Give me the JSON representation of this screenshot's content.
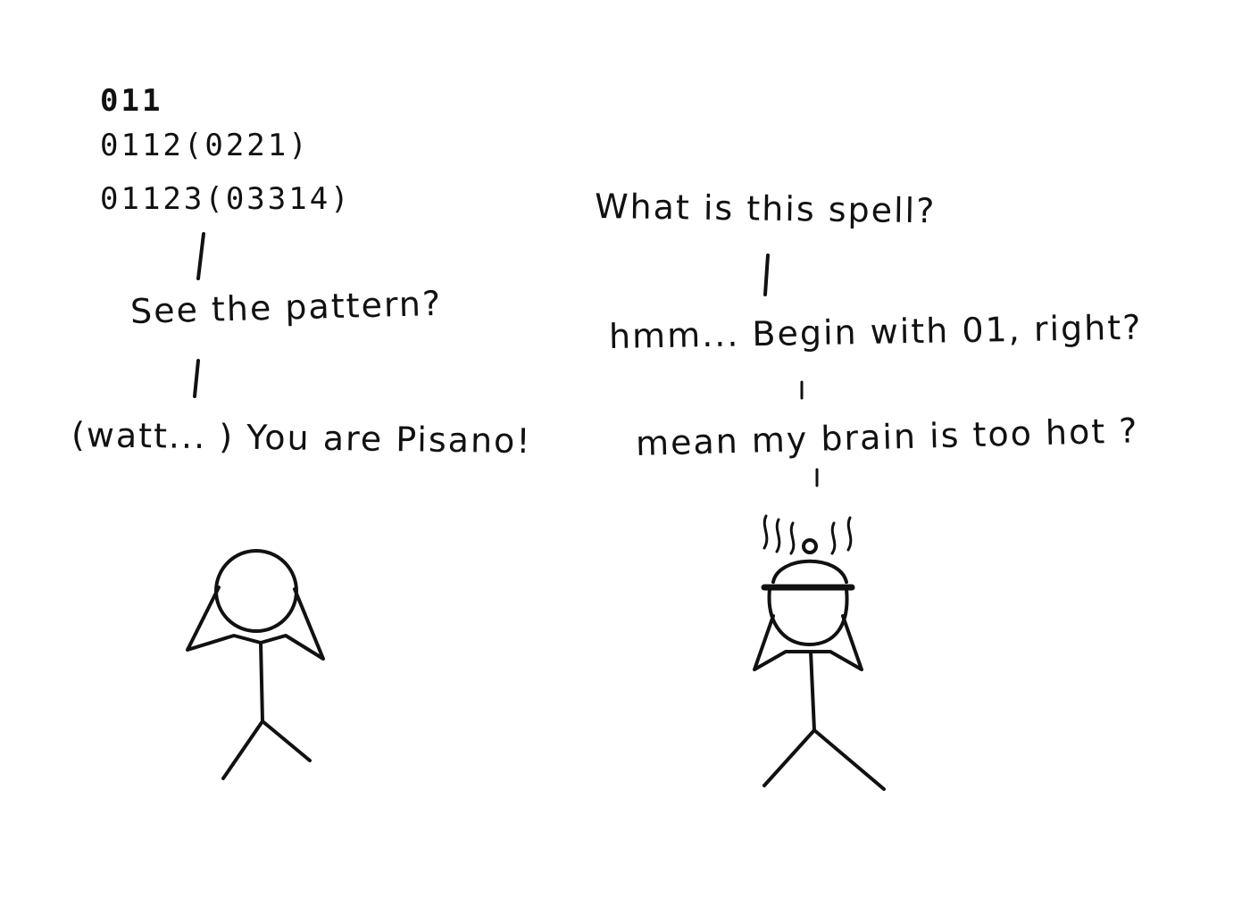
{
  "left_panel": {
    "sequence_lines": [
      "011",
      "0112(0221)",
      "01123(03314)"
    ],
    "question": "See the pattern?",
    "exclamation": "(watt... ) You are Pisano!"
  },
  "right_panel": {
    "line1": "What is this spell?",
    "line2": "hmm... Begin with 01, right?",
    "line3": "mean my brain is too hot ?"
  },
  "colors": {
    "ink": "#111111",
    "paper": "#ffffff"
  }
}
